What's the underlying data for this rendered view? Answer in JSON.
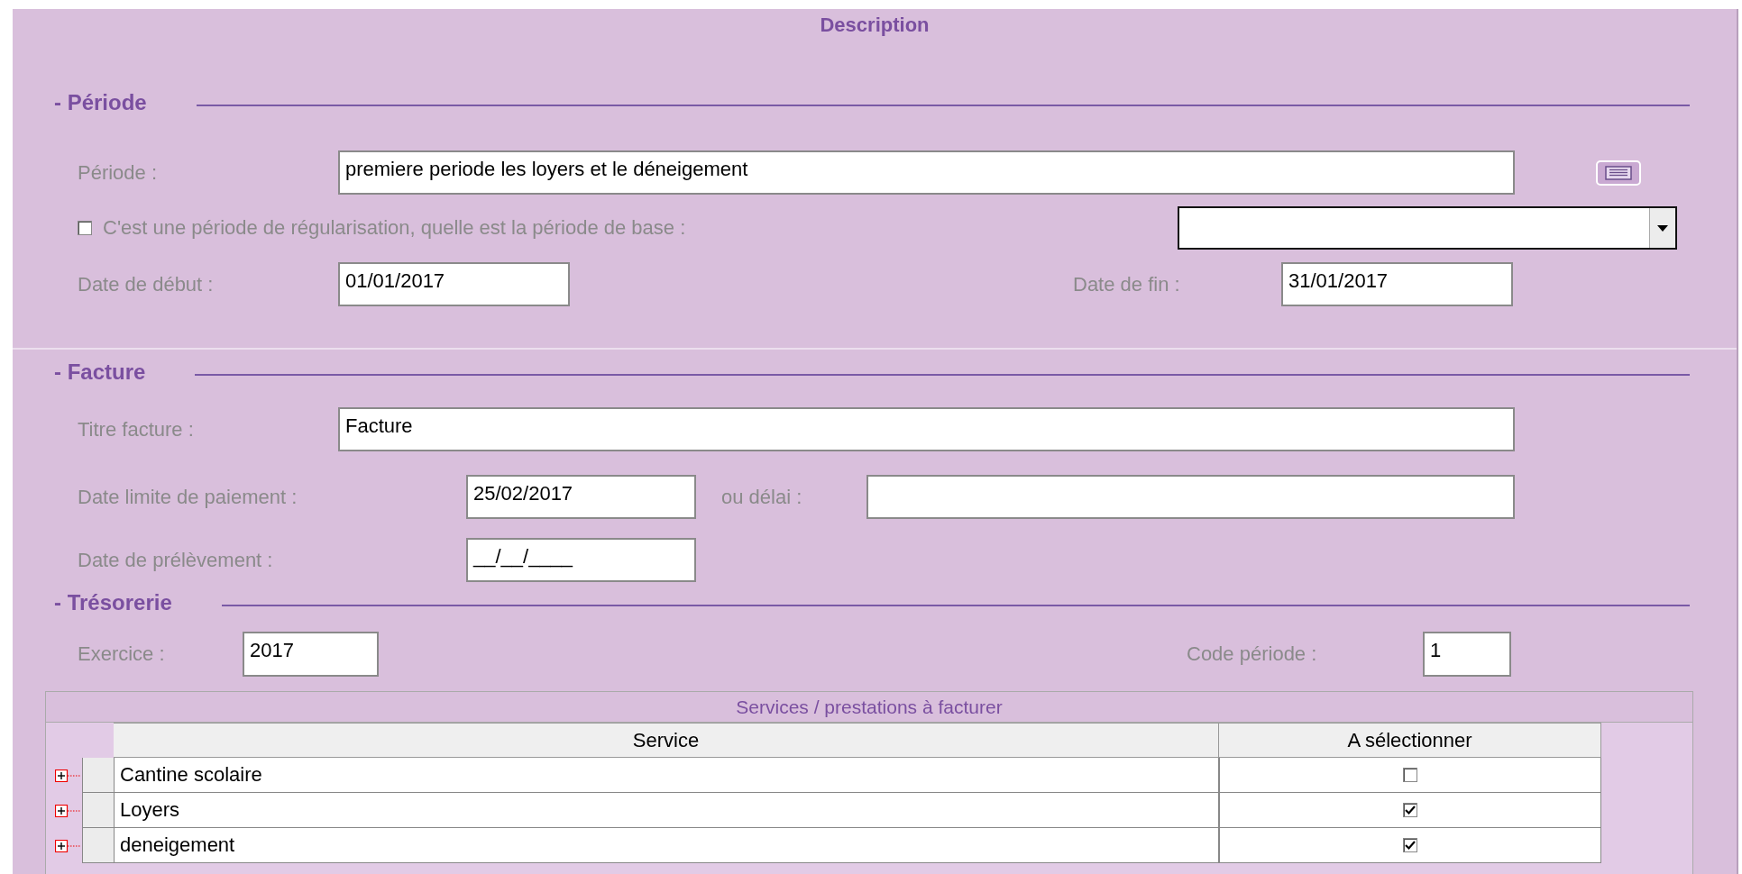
{
  "title": "Description",
  "periode": {
    "heading": "- Période",
    "periode_field": {
      "label": "Période :",
      "value": "premiere periode les loyers et le déneigement"
    },
    "regularisation": {
      "label": "C'est une période de régularisation, quelle est la période de base :",
      "checked": false
    },
    "date_debut": {
      "label": "Date de début :",
      "value": "01/01/2017"
    },
    "date_fin": {
      "label": "Date de fin :",
      "value": "31/01/2017"
    }
  },
  "facture": {
    "heading": "- Facture",
    "titre": {
      "label": "Titre facture :",
      "value": "Facture"
    },
    "date_limite": {
      "label": "Date limite de paiement :",
      "value": "25/02/2017"
    },
    "delai": {
      "label": "ou délai :"
    },
    "date_prelevement": {
      "label": "Date de prélèvement :",
      "value": "__/__/____"
    }
  },
  "tresorerie": {
    "heading": "- Trésorerie",
    "exercice": {
      "label": "Exercice :",
      "value": "2017"
    },
    "code_periode": {
      "label": "Code période :",
      "value": "1"
    }
  },
  "services": {
    "title": "Services / prestations à facturer",
    "columns": [
      "Service",
      "A sélectionner"
    ],
    "rows": [
      {
        "name": "Cantine scolaire",
        "checked": false,
        "expanded": false
      },
      {
        "name": "Loyers",
        "checked": true,
        "expanded": false
      },
      {
        "name": "deneigement",
        "checked": true,
        "expanded": false
      }
    ]
  }
}
